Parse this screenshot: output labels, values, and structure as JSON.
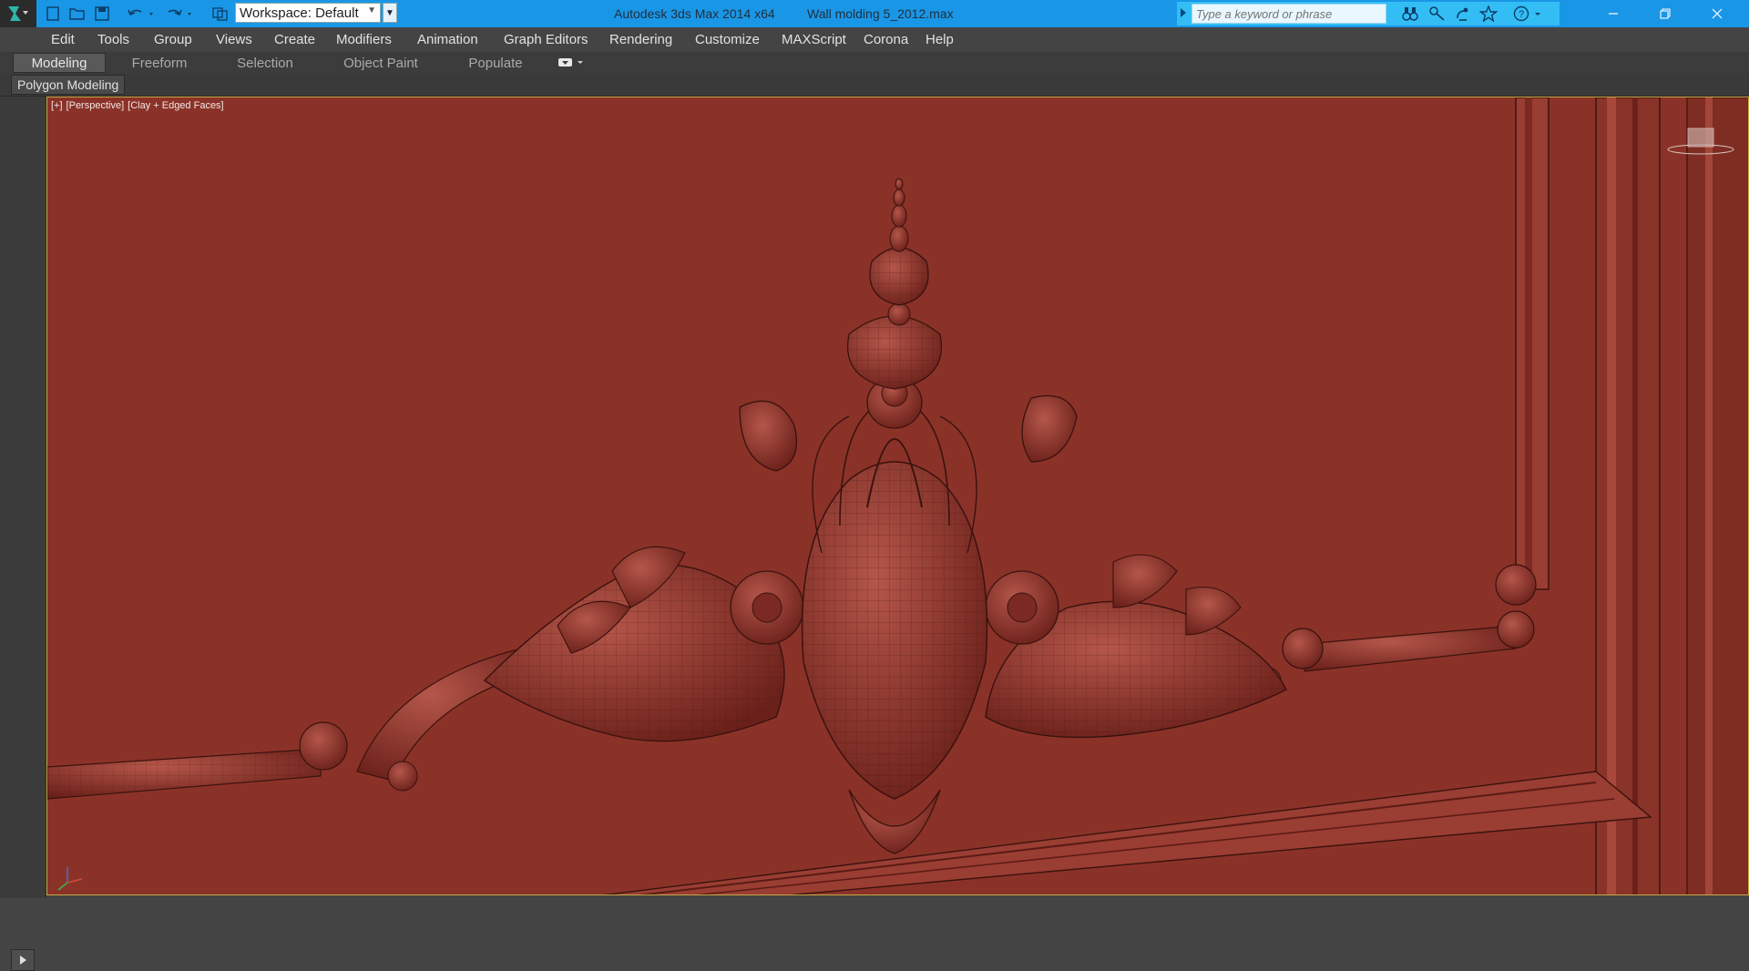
{
  "titlebar": {
    "app_title": "Autodesk 3ds Max  2014 x64",
    "file_name": "Wall molding 5_2012.max",
    "workspace_value": "Workspace: Default",
    "search_placeholder": "Type a keyword or phrase",
    "colors": {
      "bar": "#1a96e6",
      "search_bg": "#33bdf5"
    }
  },
  "quick_access": [
    {
      "icon": "app-menu-icon"
    },
    {
      "icon": "new-file-icon"
    },
    {
      "icon": "open-file-icon"
    },
    {
      "icon": "save-file-icon"
    },
    {
      "icon": "undo-icon"
    },
    {
      "icon": "redo-icon"
    },
    {
      "icon": "project-folder-icon"
    }
  ],
  "menu": {
    "items": [
      "Edit",
      "Tools",
      "Group",
      "Views",
      "Create",
      "Modifiers",
      "Animation",
      "Graph Editors",
      "Rendering",
      "Customize",
      "MAXScript",
      "Corona",
      "Help"
    ]
  },
  "ribbon": {
    "tabs": [
      {
        "label": "Modeling",
        "active": true
      },
      {
        "label": "Freeform",
        "active": false
      },
      {
        "label": "Selection",
        "active": false
      },
      {
        "label": "Object Paint",
        "active": false
      },
      {
        "label": "Populate",
        "active": false
      }
    ],
    "panel_label": "Polygon Modeling"
  },
  "viewport": {
    "label_plus": "[+]",
    "label_view": "[Perspective]",
    "label_shading": "[Clay + Edged Faces]",
    "background_color": "#8b3228"
  }
}
